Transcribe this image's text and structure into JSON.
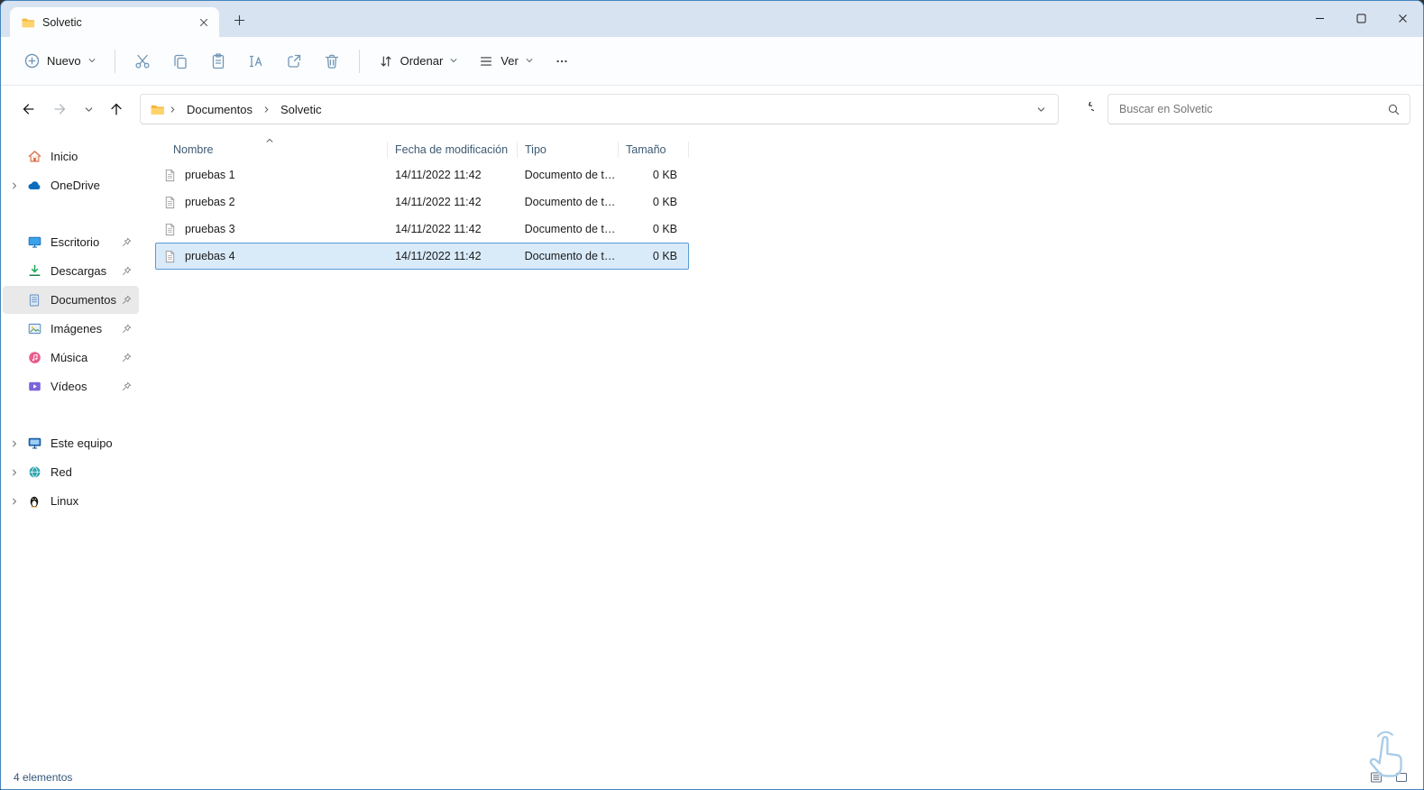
{
  "window": {
    "tab_title": "Solvetic"
  },
  "toolbar": {
    "nuevo_label": "Nuevo",
    "ordenar_label": "Ordenar",
    "ver_label": "Ver"
  },
  "navbar": {
    "breadcrumb": {
      "root": "Documentos",
      "current": "Solvetic"
    },
    "search_placeholder": "Buscar en Solvetic"
  },
  "sidebar": {
    "items": [
      {
        "label": "Inicio"
      },
      {
        "label": "OneDrive"
      },
      {
        "label": "Escritorio"
      },
      {
        "label": "Descargas"
      },
      {
        "label": "Documentos"
      },
      {
        "label": "Imágenes"
      },
      {
        "label": "Música"
      },
      {
        "label": "Vídeos"
      },
      {
        "label": "Este equipo"
      },
      {
        "label": "Red"
      },
      {
        "label": "Linux"
      }
    ]
  },
  "files": {
    "columns": {
      "name": "Nombre",
      "date": "Fecha de modificación",
      "type": "Tipo",
      "size": "Tamaño"
    },
    "rows": [
      {
        "name": "pruebas 1",
        "date": "14/11/2022 11:42",
        "type": "Documento de te...",
        "size": "0 KB"
      },
      {
        "name": "pruebas 2",
        "date": "14/11/2022 11:42",
        "type": "Documento de te...",
        "size": "0 KB"
      },
      {
        "name": "pruebas 3",
        "date": "14/11/2022 11:42",
        "type": "Documento de te...",
        "size": "0 KB"
      },
      {
        "name": "pruebas 4",
        "date": "14/11/2022 11:42",
        "type": "Documento de te...",
        "size": "0 KB"
      }
    ]
  },
  "statusbar": {
    "count": "4 elementos"
  },
  "colors": {
    "accent": "#0b66c2",
    "selection_bg": "#d9eaf9",
    "selection_border": "#5b9bd5",
    "tabstrip_bg": "#d8e3f1",
    "toolbar_icon": "#7096b6"
  },
  "icons": {
    "new": "⊕",
    "cut": "✂",
    "copy": "⧉",
    "paste": "📋",
    "rename": "A|",
    "share": "↗",
    "delete": "🗑",
    "sort": "⇅",
    "view": "≣",
    "more": "⋯",
    "back": "←",
    "forward": "→",
    "up": "↑",
    "refresh": "⟳",
    "search": "🔍",
    "chevron-down": "⌄",
    "folder": "📁",
    "pin": "📌",
    "document": "📄"
  }
}
